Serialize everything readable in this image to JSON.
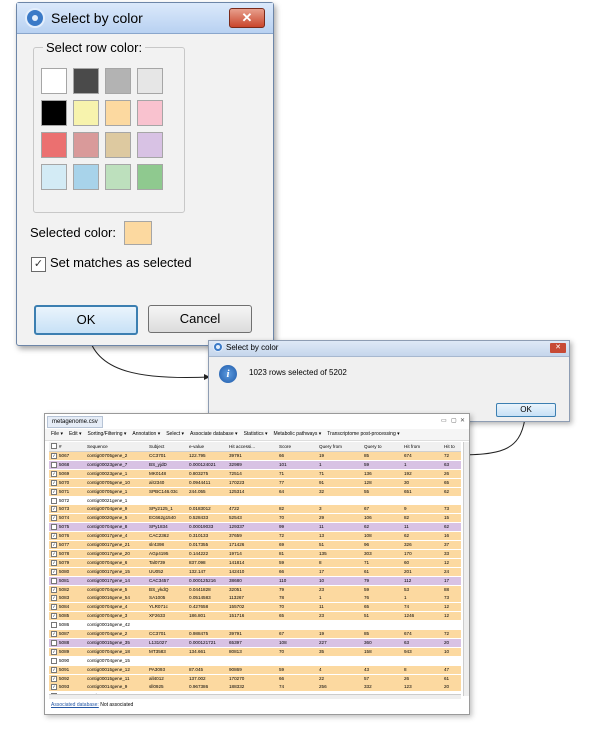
{
  "dialog1": {
    "title": "Select by color",
    "legend": "Select row color:",
    "selected_color_label": "Selected color:",
    "selected_color": "#fcd9a0",
    "checkbox_label": "Set matches as selected",
    "checkbox_checked": true,
    "ok": "OK",
    "cancel": "Cancel",
    "close": "✕",
    "swatches": [
      "#ffffff",
      "#4a4a4a",
      "#b3b3b3",
      "#e6e6e6",
      "#000000",
      "#f7f3ad",
      "#fcd9a0",
      "#f9c2cf",
      "#eb7070",
      "#d99a9a",
      "#ddc9a0",
      "#d8c2e4",
      "#d3ebf5",
      "#a8d3ea",
      "#bde0bd",
      "#8fc98f"
    ]
  },
  "dialog2": {
    "title": "Select by color",
    "message": "1023 rows selected of 5202",
    "ok": "OK",
    "close": "✕"
  },
  "app": {
    "tab": "metagenome.csv",
    "menu": [
      "File",
      "Edit",
      "Sorting/Filtering",
      "Annotation",
      "Select",
      "Associate database",
      "Statistics",
      "Metabolic pathways",
      "Transcriptome post-processing"
    ],
    "headers": [
      "#",
      "Sequence",
      "Subject",
      "e-value",
      "Hit accessi...",
      "Score",
      "Query from",
      "Query to",
      "Hit from",
      "Hit to"
    ],
    "status_link": "Associated database:",
    "status_value": "Not associated",
    "rows": [
      {
        "c": "o",
        "ck": "☑",
        "d": [
          "5067",
          "contig00705gene_2",
          "CC3701",
          "122.795",
          "39791",
          "66",
          "19",
          "85",
          "674",
          "72"
        ]
      },
      {
        "c": "p",
        "ck": "☐",
        "d": [
          "5068",
          "contig00023gene_7",
          "BS_yjdD",
          "0.000124021",
          "32989",
          "101",
          "1",
          "59",
          "1",
          "63"
        ]
      },
      {
        "c": "o",
        "ck": "☑",
        "d": [
          "5069",
          "contig00023gene_1",
          "MK0148",
          "0.803275",
          "72514",
          "71",
          "71",
          "136",
          "192",
          "26"
        ]
      },
      {
        "c": "o",
        "ck": "☑",
        "d": [
          "5070",
          "contig00705gene_10",
          "alr2340",
          "0.0944411",
          "170223",
          "77",
          "91",
          "128",
          "30",
          "65"
        ]
      },
      {
        "c": "o",
        "ck": "☑",
        "d": [
          "5071",
          "contig00705gene_1",
          "SPBC146.03c",
          "244.055",
          "125314",
          "64",
          "32",
          "55",
          "651",
          "62"
        ]
      },
      {
        "c": "w",
        "ck": "☐",
        "d": [
          "5072",
          "contig00021gene_1",
          "",
          "",
          "",
          "",
          "",
          "",
          "",
          ""
        ]
      },
      {
        "c": "o",
        "ck": "☑",
        "d": [
          "5073",
          "contig00704gene_9",
          "SPy2125_1",
          "0.0183012",
          "4722",
          "82",
          "3",
          "67",
          "9",
          "73"
        ]
      },
      {
        "c": "o",
        "ck": "☑",
        "d": [
          "5074",
          "contig00020gene_5",
          "EC662g1540",
          "0.528433",
          "52543",
          "70",
          "29",
          "106",
          "82",
          "15"
        ]
      },
      {
        "c": "p",
        "ck": "☐",
        "d": [
          "5075",
          "contig00704gene_8",
          "SPy1834",
          "0.00019033",
          "129337",
          "99",
          "11",
          "62",
          "11",
          "62"
        ]
      },
      {
        "c": "o",
        "ck": "☑",
        "d": [
          "5076",
          "contig00017gene_4",
          "CAC2362",
          "0.310133",
          "37659",
          "72",
          "13",
          "108",
          "62",
          "16"
        ]
      },
      {
        "c": "o",
        "ck": "☑",
        "d": [
          "5077",
          "contig00017gene_21",
          "slr4398",
          "0.017355",
          "171426",
          "69",
          "51",
          "96",
          "326",
          "37"
        ]
      },
      {
        "c": "o",
        "ck": "☑",
        "d": [
          "5078",
          "contig00017gene_20",
          "AGp4195",
          "0.144222",
          "19714",
          "81",
          "135",
          "303",
          "170",
          "33"
        ]
      },
      {
        "c": "o",
        "ck": "☑",
        "d": [
          "5079",
          "contig00704gene_6",
          "Tal0739",
          "837.098",
          "141814",
          "59",
          "8",
          "71",
          "60",
          "12"
        ]
      },
      {
        "c": "o",
        "ck": "☑",
        "d": [
          "5080",
          "contig00017gene_15",
          "UU052",
          "132.147",
          "142410",
          "66",
          "17",
          "61",
          "201",
          "24"
        ]
      },
      {
        "c": "p",
        "ck": "☐",
        "d": [
          "5081",
          "contig00017gene_14",
          "CAC3457",
          "0.000125216",
          "38680",
          "110",
          "10",
          "79",
          "112",
          "17"
        ]
      },
      {
        "c": "o",
        "ck": "☑",
        "d": [
          "5082",
          "contig00704gene_5",
          "BS_ykdQ",
          "0.0441828",
          "32051",
          "79",
          "23",
          "59",
          "53",
          "88"
        ]
      },
      {
        "c": "o",
        "ck": "☑",
        "d": [
          "5083",
          "contig00016gene_54",
          "SA1005",
          "0.0514583",
          "113267",
          "78",
          "1",
          "76",
          "1",
          "73"
        ]
      },
      {
        "c": "o",
        "ck": "☑",
        "d": [
          "5084",
          "contig00704gene_4",
          "YLR071c",
          "0.427658",
          "155702",
          "70",
          "11",
          "65",
          "74",
          "12"
        ]
      },
      {
        "c": "o",
        "ck": "☑",
        "d": [
          "5085",
          "contig00704gene_3",
          "XF2633",
          "186.801",
          "151716",
          "65",
          "23",
          "51",
          "1246",
          "12"
        ]
      },
      {
        "c": "w",
        "ck": "☐",
        "d": [
          "5086",
          "contig00016gene_42",
          "",
          "",
          "",
          "",
          "",
          "",
          "",
          ""
        ]
      },
      {
        "c": "o",
        "ck": "☑",
        "d": [
          "5087",
          "contig00704gene_2",
          "CC3701",
          "0.988475",
          "39791",
          "67",
          "19",
          "85",
          "674",
          "72"
        ]
      },
      {
        "c": "p",
        "ck": "☐",
        "d": [
          "5088",
          "contig00015gene_35",
          "L131027",
          "0.000121721",
          "65397",
          "108",
          "227",
          "360",
          "63",
          "20"
        ]
      },
      {
        "c": "o",
        "ck": "☑",
        "d": [
          "5089",
          "contig00704gene_18",
          "MT3583",
          "134.661",
          "80813",
          "70",
          "35",
          "158",
          "943",
          "10"
        ]
      },
      {
        "c": "w",
        "ck": "☐",
        "d": [
          "5090",
          "contig00704gene_15",
          "",
          "",
          "",
          "",
          "",
          "",
          "",
          ""
        ]
      },
      {
        "c": "o",
        "ck": "☑",
        "d": [
          "5091",
          "contig00015gene_12",
          "PA3093",
          "87.045",
          "90869",
          "59",
          "4",
          "43",
          "8",
          "47"
        ]
      },
      {
        "c": "o",
        "ck": "☑",
        "d": [
          "5092",
          "contig00015gene_11",
          "all4012",
          "137.002",
          "170270",
          "66",
          "22",
          "57",
          "26",
          "61"
        ]
      },
      {
        "c": "o",
        "ck": "☑",
        "d": [
          "5093",
          "contig00014gene_9",
          "sll0925",
          "0.967386",
          "188332",
          "74",
          "256",
          "332",
          "123",
          "20"
        ]
      },
      {
        "c": "w",
        "ck": "☐",
        "d": [
          "5094",
          "contig00014gene_12",
          "",
          "",
          "",
          "",
          "",
          "",
          "",
          ""
        ]
      }
    ]
  },
  "colors": {
    "orange": "#fcd9a0",
    "purple": "#d8c2e4",
    "white": "#ffffff"
  }
}
